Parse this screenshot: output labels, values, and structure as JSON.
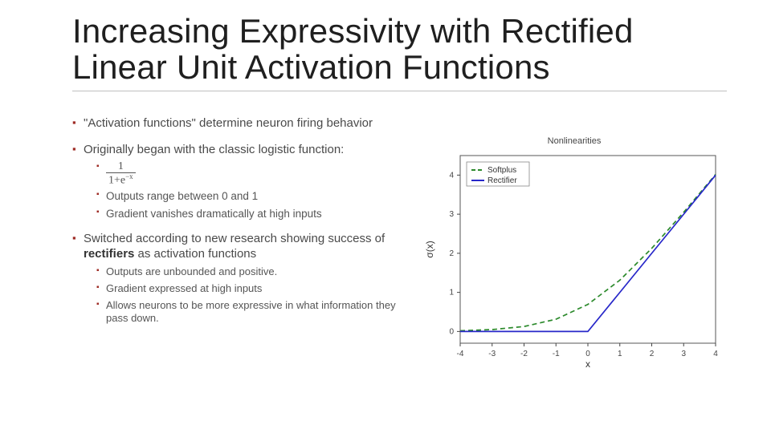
{
  "title": "Increasing Expressivity with Rectified Linear Unit Activation Functions",
  "bullets": {
    "b1": "\"Activation functions\" determine neuron firing behavior",
    "b2": "Originally began with the classic logistic function:",
    "b2a_num": "1",
    "b2a_den_pre": "1+e",
    "b2a_den_sup": "−x",
    "b2b": "Outputs range between 0 and 1",
    "b2c": "Gradient vanishes dramatically at high inputs",
    "b3_pre": "Switched according to new research showing success of ",
    "b3_bold": "rectifiers",
    "b3_post": " as activation functions",
    "b3a": "Outputs are unbounded and positive.",
    "b3b": "Gradient expressed at high inputs",
    "b3c": "Allows neurons to be more expressive in what information they pass down."
  },
  "chart_data": {
    "type": "line",
    "title": "Nonlinearities",
    "xlabel": "x",
    "ylabel": "σ(x)",
    "xlim": [
      -4,
      4
    ],
    "ylim": [
      -0.3,
      4.5
    ],
    "x_ticks": [
      -4,
      -3,
      -2,
      -1,
      0,
      1,
      2,
      3,
      4
    ],
    "y_ticks": [
      0,
      1,
      2,
      3,
      4
    ],
    "legend": [
      "Softplus",
      "Rectifier"
    ],
    "series": [
      {
        "name": "Softplus",
        "color": "#2c8a2c",
        "dashed": true,
        "x": [
          -4,
          -3,
          -2,
          -1,
          0,
          1,
          2,
          3,
          4
        ],
        "y": [
          0.018,
          0.049,
          0.127,
          0.313,
          0.693,
          1.313,
          2.127,
          3.049,
          4.018
        ]
      },
      {
        "name": "Rectifier",
        "color": "#2727c9",
        "dashed": false,
        "x": [
          -4,
          -3,
          -2,
          -1,
          0,
          1,
          2,
          3,
          4
        ],
        "y": [
          0,
          0,
          0,
          0,
          0,
          1,
          2,
          3,
          4
        ]
      }
    ]
  }
}
